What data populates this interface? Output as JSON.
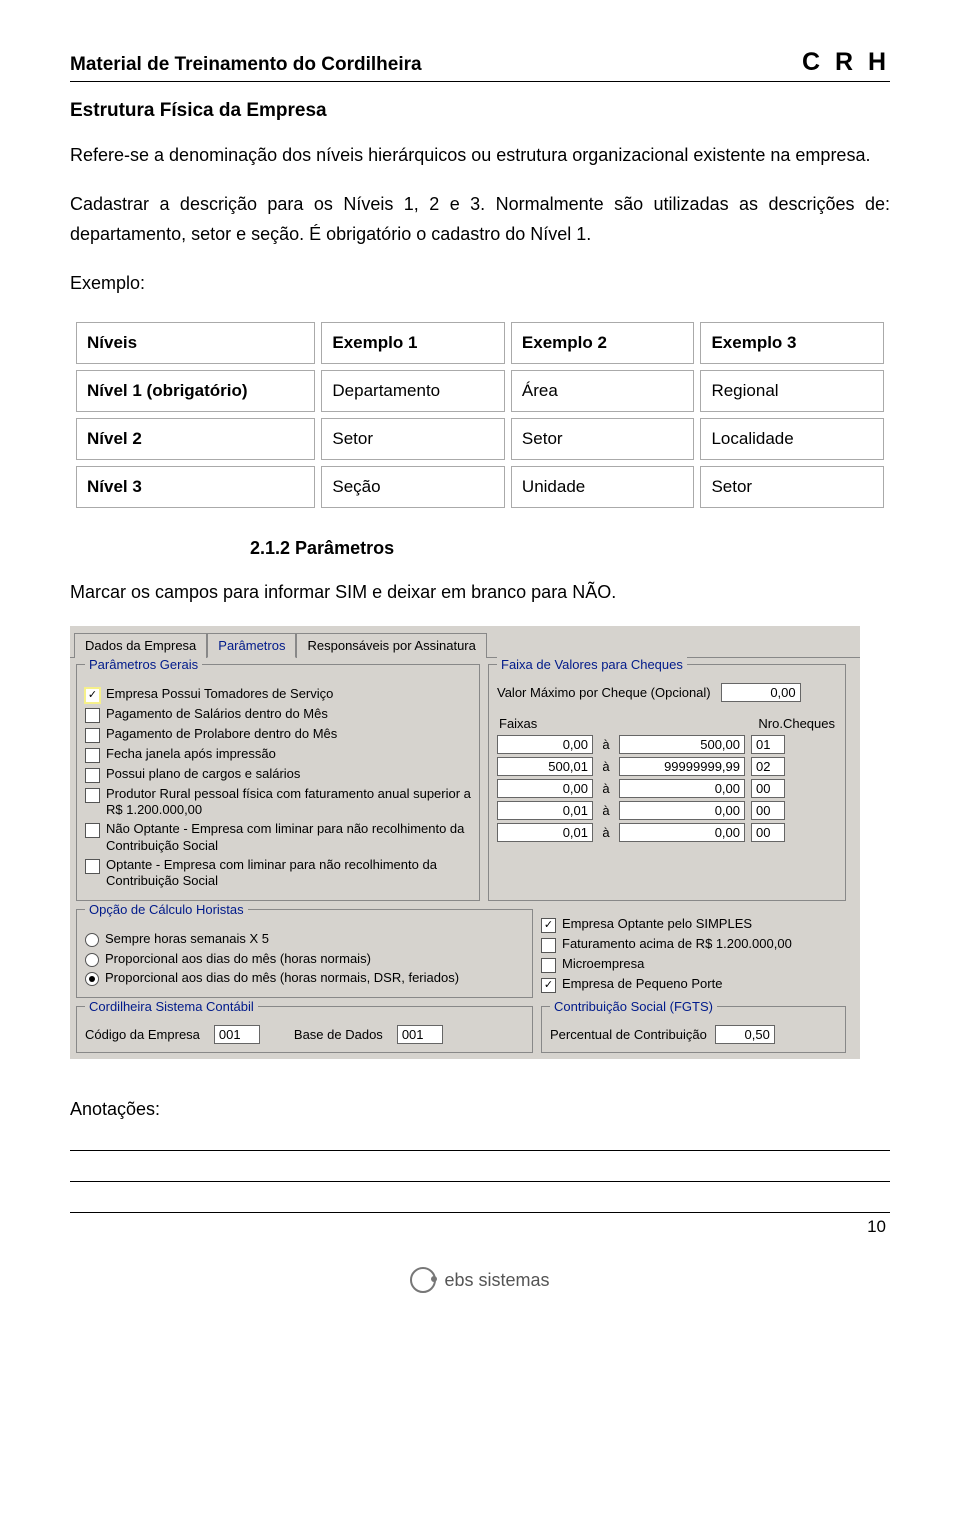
{
  "header": {
    "left": "Material de Treinamento do Cordilheira",
    "right": "C R H"
  },
  "section_title": "Estrutura Física da Empresa",
  "paragraphs": {
    "p1": "Refere-se a denominação dos níveis hierárquicos ou estrutura organizacional existente na empresa.",
    "p2": "Cadastrar a descrição para os Níveis 1, 2 e 3. Normalmente são utilizadas as descrições de: departamento, setor e seção. É obrigatório o cadastro do Nível 1.",
    "p3": "Exemplo:"
  },
  "table": {
    "head": [
      "Níveis",
      "Exemplo 1",
      "Exemplo 2",
      "Exemplo 3"
    ],
    "rows": [
      [
        "Nível 1  (obrigatório)",
        "Departamento",
        "Área",
        "Regional"
      ],
      [
        "Nível 2",
        "Setor",
        "Setor",
        "Localidade"
      ],
      [
        "Nível 3",
        "Seção",
        "Unidade",
        "Setor"
      ]
    ]
  },
  "sub_heading": "2.1.2 Parâmetros",
  "instruction": "Marcar os campos para informar SIM e deixar em branco para NÃO.",
  "ui": {
    "tabs": {
      "t0": "Dados da Empresa",
      "t1": "Parâmetros",
      "t2": "Responsáveis por Assinatura"
    },
    "gerais": {
      "legend": "Parâmetros Gerais",
      "items": [
        {
          "label": "Empresa Possui Tomadores de Serviço",
          "checked": true,
          "hl": true
        },
        {
          "label": "Pagamento de Salários dentro do Mês",
          "checked": false
        },
        {
          "label": "Pagamento de Prolabore dentro do Mês",
          "checked": false
        },
        {
          "label": "Fecha janela após impressão",
          "checked": false
        },
        {
          "label": "Possui plano de cargos e salários",
          "checked": false
        },
        {
          "label": "Produtor Rural pessoal física com faturamento anual superior a R$ 1.200.000,00",
          "checked": false
        },
        {
          "label": "Não Optante - Empresa com liminar para não recolhimento da Contribuição Social",
          "checked": false
        },
        {
          "label": "Optante - Empresa com liminar para não recolhimento da Contribuição Social",
          "checked": false
        }
      ]
    },
    "cheques": {
      "legend": "Faixa de Valores para Cheques",
      "max_label": "Valor Máximo por Cheque (Opcional)",
      "max_value": "0,00",
      "head_faixas": "Faixas",
      "head_nro": "Nro.Cheques",
      "sep": "à",
      "rows": [
        {
          "a": "0,00",
          "b": "500,00",
          "n": "01"
        },
        {
          "a": "500,01",
          "b": "99999999,99",
          "n": "02"
        },
        {
          "a": "0,00",
          "b": "0,00",
          "n": "00"
        },
        {
          "a": "0,01",
          "b": "0,00",
          "n": "00"
        },
        {
          "a": "0,01",
          "b": "0,00",
          "n": "00"
        }
      ]
    },
    "horistas": {
      "legend": "Opção de Cálculo Horistas",
      "opts": [
        {
          "label": "Sempre horas semanais X 5",
          "checked": false
        },
        {
          "label": "Proporcional aos dias do mês (horas normais)",
          "checked": false
        },
        {
          "label": "Proporcional aos dias do mês (horas normais, DSR, feriados)",
          "checked": true
        }
      ]
    },
    "simples": {
      "items": [
        {
          "label": "Empresa Optante pelo SIMPLES",
          "checked": true
        },
        {
          "label": "Faturamento acima de R$ 1.200.000,00",
          "checked": false
        },
        {
          "label": "Microempresa",
          "checked": false
        },
        {
          "label": "Empresa de Pequeno Porte",
          "checked": true
        }
      ]
    },
    "contabil": {
      "legend": "Cordilheira Sistema Contábil",
      "codigo_label": "Código da Empresa",
      "codigo_value": "001",
      "base_label": "Base de Dados",
      "base_value": "001"
    },
    "fgts": {
      "legend": "Contribuição Social (FGTS)",
      "perc_label": "Percentual de Contribuição",
      "perc_value": "0,50"
    }
  },
  "anotacoes_label": "Anotações:",
  "footer_brand": "ebs sistemas",
  "page_number": "10"
}
